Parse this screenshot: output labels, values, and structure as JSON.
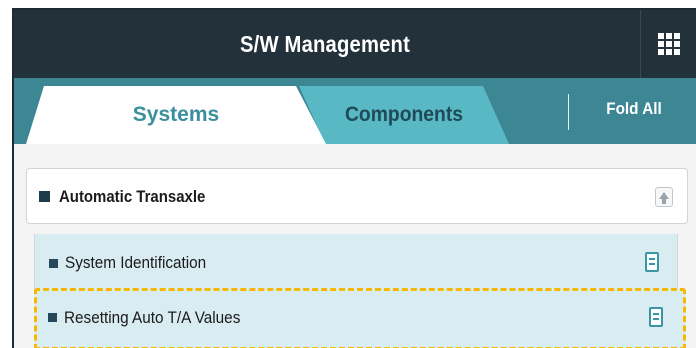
{
  "header": {
    "title": "S/W Management",
    "menu_icon": "grid-menu-icon"
  },
  "tabs": [
    {
      "label": "Systems",
      "active": true
    },
    {
      "label": "Components",
      "active": false
    }
  ],
  "fold_all_label": "Fold All",
  "section": {
    "title": "Automatic Transaxle",
    "collapse_icon": "collapse-up-icon",
    "items": [
      {
        "label": "System Identification",
        "icon": "document-icon",
        "highlighted": false
      },
      {
        "label": "Resetting Auto T/A Values",
        "icon": "document-icon",
        "highlighted": true
      }
    ]
  },
  "colors": {
    "titlebar": "#23313b",
    "tabbar": "#3d8794",
    "active_tab_text": "#3a8f9c",
    "inactive_tab": "#58b9c4",
    "item_background": "#d8ecf1",
    "highlight_border": "#f6b800"
  }
}
